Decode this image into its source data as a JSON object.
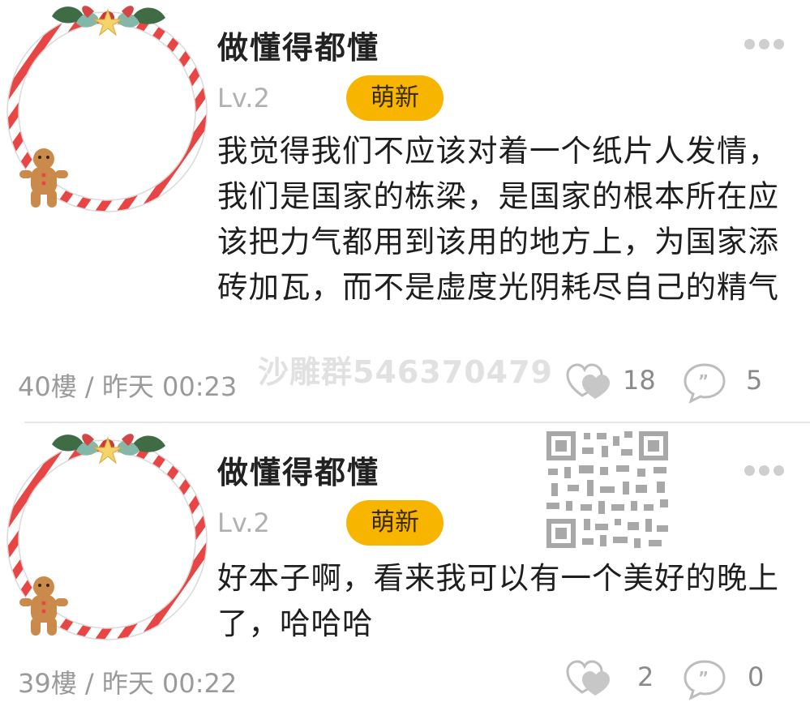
{
  "posts": [
    {
      "username": "做懂得都懂",
      "level": "Lv.2",
      "badge": "萌新",
      "content": "我觉得我们不应该对着一个纸片人发情，我们是国家的栋梁，是国家的根本所在应该把力气都用到该用的地方上，为国家添砖加瓦，而不是虚度光阴耗尽自己的精气",
      "floor_time": "40樓 / 昨天 00:23",
      "likes": "18",
      "comments": "5"
    },
    {
      "username": "做懂得都懂",
      "level": "Lv.2",
      "badge": "萌新",
      "content": "好本子啊，看来我可以有一个美好的晚上了，哈哈哈",
      "floor_time": "39樓 / 昨天 00:22",
      "likes": "2",
      "comments": "0"
    }
  ],
  "watermark": "沙雕群546370479",
  "icons": {
    "avatar_frame": "christmas-wreath",
    "more": "more-dots-icon",
    "like": "heart-like-icon",
    "comment": "comment-bubble-icon"
  },
  "colors": {
    "badge": "#f7b500",
    "muted_text": "#9a9a9a"
  }
}
